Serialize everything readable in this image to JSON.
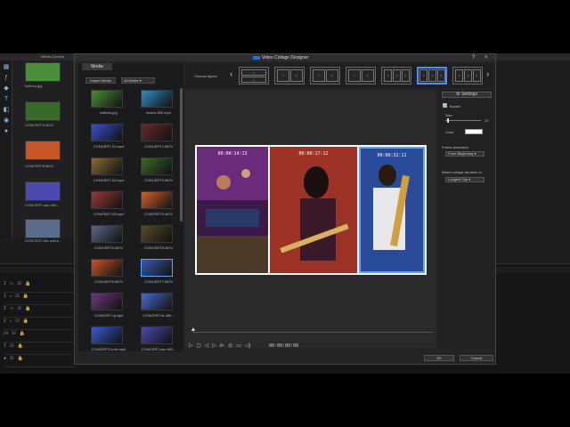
{
  "background_app": {
    "media_label": "Media Content",
    "library_items": [
      {
        "label": "balloon.jpg"
      },
      {
        "label": "CONCERT2.MOV"
      },
      {
        "label": "CONCERT6.MOV"
      },
      {
        "label": "CONCERT-sax-480..."
      },
      {
        "label": "CONCERT-the-wall-h..."
      }
    ],
    "tracks": [
      {
        "num": "1",
        "icon": "video-icon"
      },
      {
        "num": "1",
        "icon": "audio-icon"
      },
      {
        "num": "2",
        "icon": "video-icon"
      },
      {
        "num": "2",
        "icon": "audio-icon"
      },
      {
        "num": "",
        "icon": "fx-icon"
      },
      {
        "num": "",
        "icon": "title-icon"
      },
      {
        "num": "",
        "icon": "voice-icon"
      }
    ]
  },
  "dialog": {
    "title": "Video Collage Designer",
    "media_panel": {
      "tab": "Media",
      "import_label": "Import Media",
      "filter_value": "All Media",
      "items": [
        {
          "label": "balloon.jpg",
          "color": "#4a8f3a"
        },
        {
          "label": "beach-360.mp4",
          "color": "#2e8ec2"
        },
        {
          "label": "CONCERT-01.mp4",
          "color": "#3a4fd0"
        },
        {
          "label": "CONCERT1.MOV",
          "color": "#6a2a2a"
        },
        {
          "label": "CONCERT-02.mp4",
          "color": "#8a6a3a"
        },
        {
          "label": "CONCERT2.MOV",
          "color": "#3a6a2a"
        },
        {
          "label": "CONCERT-03.mp4",
          "color": "#9a3a3a"
        },
        {
          "label": "CONCERT3.MOV",
          "color": "#d4602a"
        },
        {
          "label": "CONCERT4.MOV",
          "color": "#5a6a8a"
        },
        {
          "label": "CONCERT5.MOV",
          "color": "#5a4a2a"
        },
        {
          "label": "CONCERT6.MOV",
          "color": "#c8552a"
        },
        {
          "label": "CONCERT7.MOV",
          "color": "#3a5ab0"
        },
        {
          "label": "CONCERT-dj.mp4",
          "color": "#6a3a7a"
        },
        {
          "label": "CONCERT-hi-480...",
          "color": "#4a6ad0"
        },
        {
          "label": "CONCERT-hi-hd.mp4",
          "color": "#3a5ad0"
        },
        {
          "label": "CONCERT-sax-480...",
          "color": "#4a4ab0"
        }
      ]
    },
    "layout_bar": {
      "choose_label": "Choose layout",
      "layouts": [
        {
          "cells": [
            [
              "1",
              "2"
            ]
          ],
          "orient": "rows"
        },
        {
          "cells": [
            [
              "1",
              "2"
            ]
          ],
          "orient": "cols"
        },
        {
          "cells": [
            [
              "1",
              "2"
            ]
          ],
          "orient": "cols"
        },
        {
          "cells": [
            [
              "1",
              "2"
            ]
          ],
          "orient": "diag"
        },
        {
          "cells": [
            [
              "1",
              "2",
              "3"
            ]
          ],
          "orient": "mix"
        },
        {
          "cells": [
            [
              "1",
              "2",
              "3"
            ]
          ],
          "orient": "cols3"
        },
        {
          "cells": [
            [
              "1",
              "2",
              "3"
            ]
          ],
          "orient": "mix2"
        }
      ]
    },
    "preview": {
      "panels": [
        {
          "timestamp": "00:00:14:13",
          "color": "#5a2a6a"
        },
        {
          "timestamp": "00:00:17:12",
          "color": "#8a2a2a"
        },
        {
          "timestamp": "00:00:32:11",
          "color": "#2a4a9a"
        }
      ],
      "timecode": "00:00:00:00"
    },
    "settings": {
      "settings_label": "Settings",
      "border_label": "Border",
      "size_label": "Size",
      "size_value": "10",
      "color_label": "Color",
      "border_color": "#ffffff",
      "frame_animation_label": "Frame animation",
      "frame_animation_value": "From Beginning",
      "match_label": "Match collage duration to",
      "match_value": "Longest Clip"
    },
    "ok_label": "OK",
    "cancel_label": "Cancel"
  }
}
